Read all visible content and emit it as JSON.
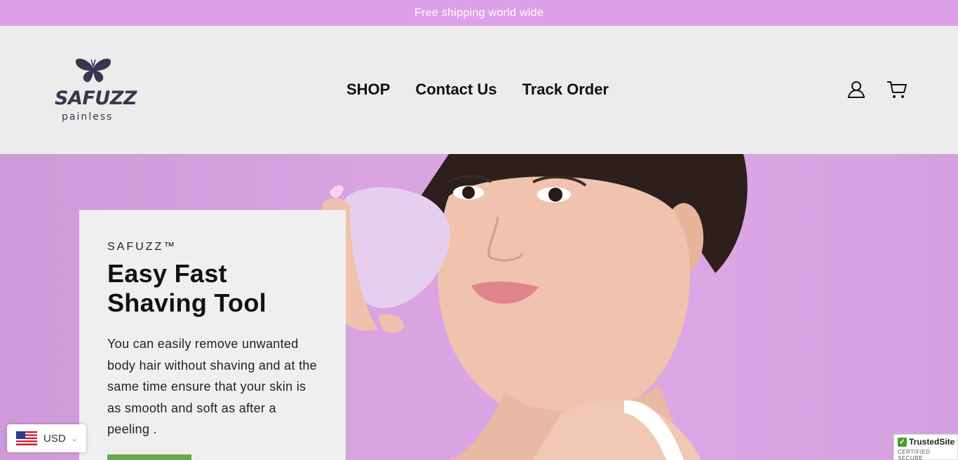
{
  "announcement": {
    "text": "Free shipping world wide"
  },
  "brand": {
    "name": "SAFUZZ",
    "tagline": "painless",
    "logo_icon": "butterfly-icon"
  },
  "nav": {
    "items": [
      {
        "label": "SHOP"
      },
      {
        "label": "Contact Us"
      },
      {
        "label": "Track Order"
      }
    ]
  },
  "header_icons": {
    "account": "account-icon",
    "cart": "cart-icon"
  },
  "hero": {
    "eyebrow": "SAFUZZ™",
    "title_line1": "Easy Fast",
    "title_line2": "Shaving Tool",
    "body": "You can easily remove unwanted body hair without shaving and at the same time ensure that your skin is as smooth and soft as after a peeling .",
    "cta_color": "#6aa84f"
  },
  "currency": {
    "code": "USD",
    "flag": "us-flag-icon"
  },
  "badge": {
    "title": "TrustedSite",
    "subtitle": "CERTIFIED SECURE"
  },
  "colors": {
    "announcement_bg": "#dca0e8",
    "hero_bg": "#d9a4e2",
    "header_bg": "#ececec"
  }
}
